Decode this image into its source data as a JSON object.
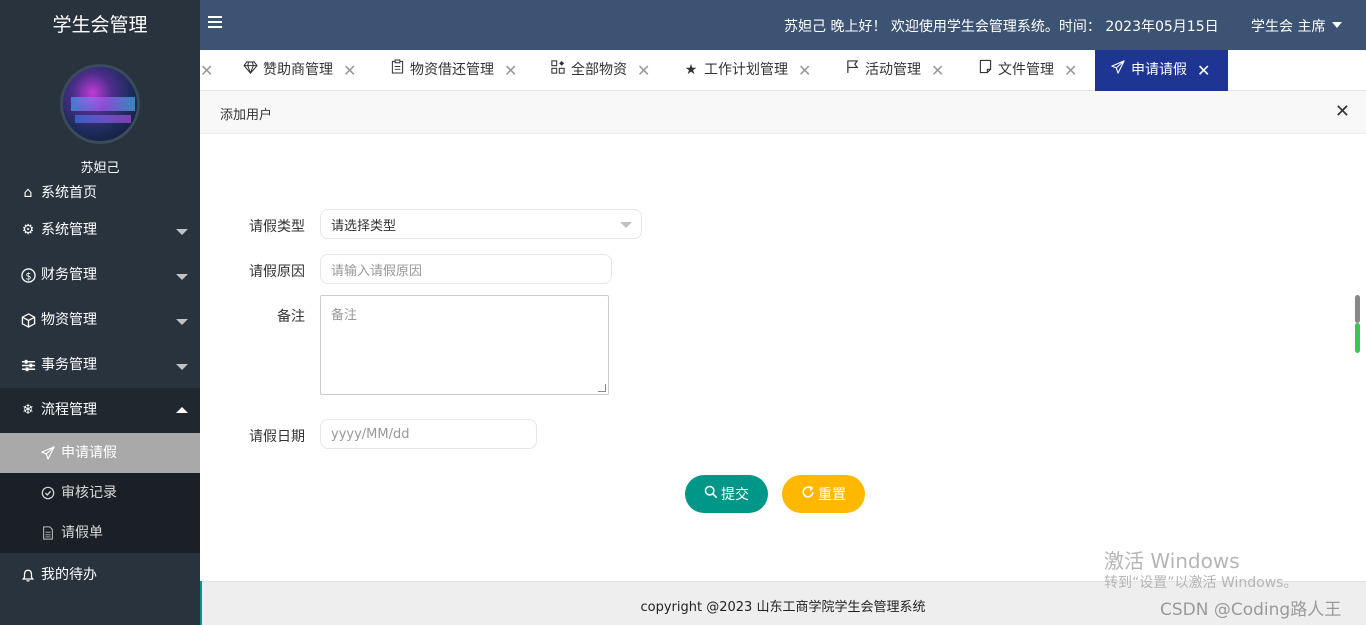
{
  "app": {
    "brand": "学生会管理",
    "username": "苏妲己"
  },
  "header": {
    "greeting": "苏妲己 晚上好！ 欢迎使用学生会管理系统。时间：  2023年05月15日",
    "role": "学生会 主席"
  },
  "sidebar": {
    "items": [
      {
        "label": "系统首页",
        "icon": "home-icon"
      },
      {
        "label": "系统管理",
        "icon": "gear-icon"
      },
      {
        "label": "财务管理",
        "icon": "dollar-icon"
      },
      {
        "label": "物资管理",
        "icon": "box-icon"
      },
      {
        "label": "事务管理",
        "icon": "sliders-icon"
      },
      {
        "label": "流程管理",
        "icon": "snowflake-icon"
      }
    ],
    "subitems": [
      {
        "label": "申请请假",
        "icon": "paper-plane-icon"
      },
      {
        "label": "审核记录",
        "icon": "check-circle-icon"
      },
      {
        "label": "请假单",
        "icon": "document-icon"
      }
    ],
    "bottom": {
      "label": "我的待办",
      "icon": "bell-icon"
    }
  },
  "tabs": [
    {
      "label": "赞助商管理",
      "icon": "diamond-icon"
    },
    {
      "label": "物资借还管理",
      "icon": "clipboard-icon"
    },
    {
      "label": "全部物资",
      "icon": "grid-icon"
    },
    {
      "label": "工作计划管理",
      "icon": "star-icon"
    },
    {
      "label": "活动管理",
      "icon": "flag-icon"
    },
    {
      "label": "文件管理",
      "icon": "note-icon"
    },
    {
      "label": "申请请假",
      "icon": "paper-plane-icon"
    }
  ],
  "panel": {
    "title": "添加用户"
  },
  "form": {
    "type_label": "请假类型",
    "type_value": "请选择类型",
    "reason_label": "请假原因",
    "reason_placeholder": "请输入请假原因",
    "remark_label": "备注",
    "remark_placeholder": "备注",
    "date_label": "请假日期",
    "date_placeholder": "yyyy/MM/dd",
    "submit_label": "提交",
    "reset_label": "重置"
  },
  "footer": {
    "text": "copyright @2023 山东工商学院学生会管理系统"
  },
  "watermarks": {
    "windows_title": "激活 Windows",
    "windows_sub": "转到“设置”以激活 Windows。",
    "csdn": "CSDN @Coding路人王"
  },
  "colors": {
    "sidebar_bg": "#28333e",
    "header_bg": "#3d5373",
    "active_tab": "#1e3594",
    "submit": "#009688",
    "reset": "#ffb800"
  }
}
